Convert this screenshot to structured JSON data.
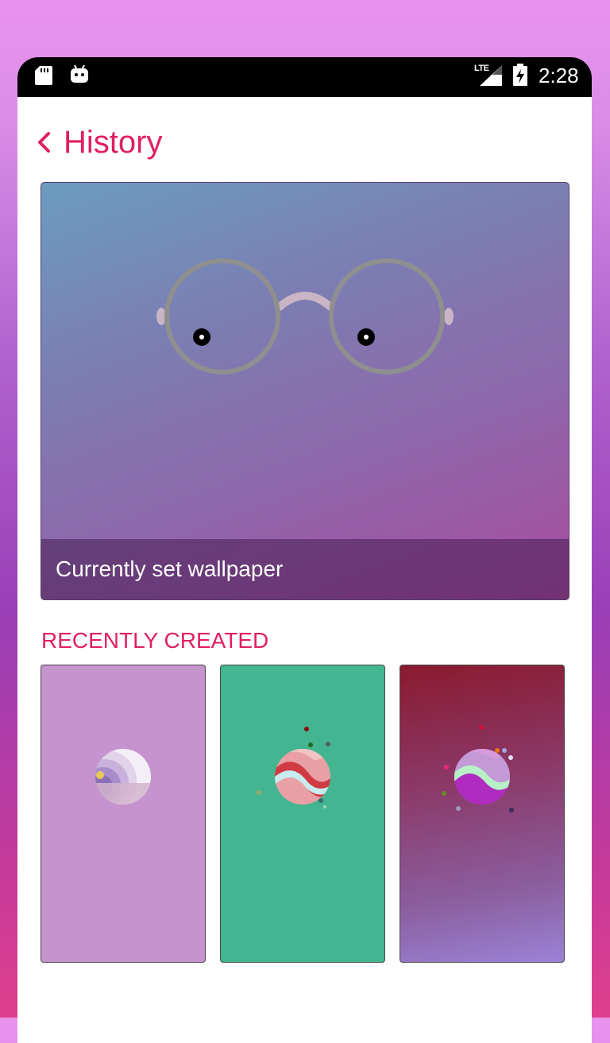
{
  "status_bar": {
    "network": "LTE",
    "time": "2:28"
  },
  "header": {
    "title": "History"
  },
  "current": {
    "caption": "Currently set wallpaper"
  },
  "recent": {
    "label": "RECENTLY CREATED",
    "items": [
      {
        "background": "#c593cd"
      },
      {
        "background": "#43b591"
      },
      {
        "background": "#8a1a30"
      }
    ]
  },
  "colors": {
    "accent": "#e0205f"
  }
}
